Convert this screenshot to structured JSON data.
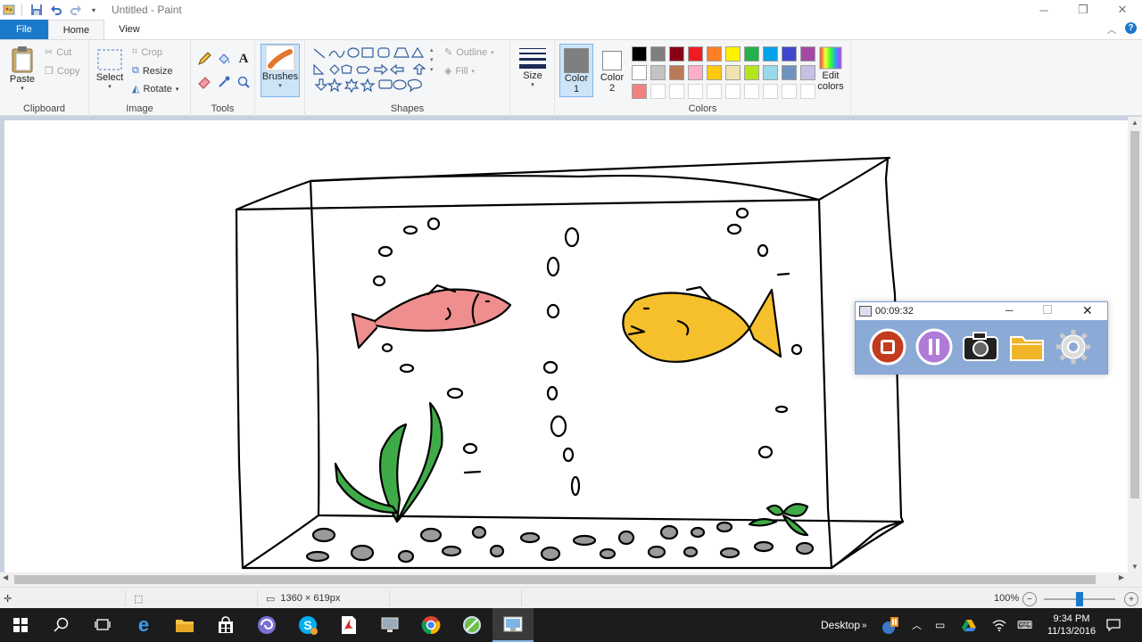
{
  "window": {
    "title": "Untitled - Paint"
  },
  "ribbon_tabs": [
    "File",
    "Home",
    "View"
  ],
  "clipboard": {
    "paste": "Paste",
    "cut": "Cut",
    "copy": "Copy",
    "label": "Clipboard"
  },
  "image": {
    "select": "Select",
    "crop": "Crop",
    "resize": "Resize",
    "rotate": "Rotate",
    "label": "Image"
  },
  "tools": {
    "label": "Tools",
    "brushes": "Brushes"
  },
  "shapes": {
    "outline": "Outline",
    "fill": "Fill",
    "label": "Shapes"
  },
  "size": {
    "label": "Size"
  },
  "colors": {
    "color1_line1": "Color",
    "color1_line2": "1",
    "color2_line1": "Color",
    "color2_line2": "2",
    "edit_line1": "Edit",
    "edit_line2": "colors",
    "label": "Colors",
    "color1_value": "#7f7f7f",
    "color2_value": "#ffffff",
    "palette_row1": [
      "#000000",
      "#7f7f7f",
      "#880015",
      "#ed1c24",
      "#ff7f27",
      "#fff200",
      "#22b14c",
      "#00a2e8",
      "#3f48cc",
      "#a349a4"
    ],
    "palette_row2": [
      "#ffffff",
      "#c3c3c3",
      "#b97a57",
      "#ffaec9",
      "#ffc90e",
      "#efe4b0",
      "#b5e61d",
      "#99d9ea",
      "#7092be",
      "#c8bfe7"
    ],
    "palette_row3": [
      "#f28282"
    ]
  },
  "status": {
    "canvas_size": "1360 × 619px",
    "zoom": "100%"
  },
  "recorder": {
    "timer": "00:09:32"
  },
  "taskbar": {
    "desktop_label": "Desktop",
    "time": "9:34 PM",
    "date": "11/13/2016"
  }
}
